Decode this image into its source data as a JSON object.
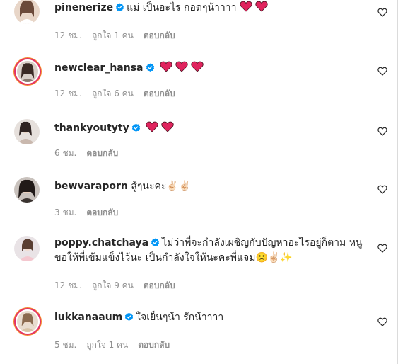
{
  "comments": [
    {
      "username": "pinenerize",
      "verified": true,
      "text": "แม่ เป็นอะไร กอดๆน้าาาา",
      "emojis": "heart2",
      "time": "12 ชม.",
      "likes": "ถูกใจ 1 คน",
      "reply": "ตอบกลับ"
    },
    {
      "username": "newclear_hansa",
      "verified": true,
      "text": "",
      "emojis": "heart3",
      "time": "12 ชม.",
      "likes": "ถูกใจ 6 คน",
      "reply": "ตอบกลับ"
    },
    {
      "username": "thankyoutyty",
      "verified": true,
      "text": "",
      "emojis": "heart2",
      "time": "6 ชม.",
      "likes": "",
      "reply": "ตอบกลับ"
    },
    {
      "username": "bewvaraporn",
      "verified": false,
      "text": "สู้ๆนะคะ✌🏻✌🏻",
      "time": "3 ชม.",
      "likes": "",
      "reply": "ตอบกลับ"
    },
    {
      "username": "poppy.chatchaya",
      "verified": true,
      "text": "ไม่ว่าพี่จะกำลังเผชิญกับปัญหาอะไรอยู่ก็ตาม หนูขอให้พี่เข้มแข็งไว้นะ เป็นกำลังใจให้นะคะพี่แจม🙁✌🏻✨",
      "time": "12 ชม.",
      "likes": "ถูกใจ 9 คน",
      "reply": "ตอบกลับ"
    },
    {
      "username": "lukkanaaum",
      "verified": true,
      "text": "ใจเย็นๆน้า รักน้าาาา",
      "time": "5 ชม.",
      "likes": "ถูกใจ 1 คน",
      "reply": "ตอบกลับ"
    }
  ],
  "icons": {
    "verified": "verified-badge-icon",
    "like": "heart-outline-icon",
    "emoji_heart": "red-heart-emoji"
  },
  "colors": {
    "username": "#262626",
    "meta": "#8e8e8e",
    "verified": "#0095f6",
    "heart_emoji": "#e0245e",
    "story_ring_start": "#f58529",
    "story_ring_end": "#dd2a7b"
  }
}
